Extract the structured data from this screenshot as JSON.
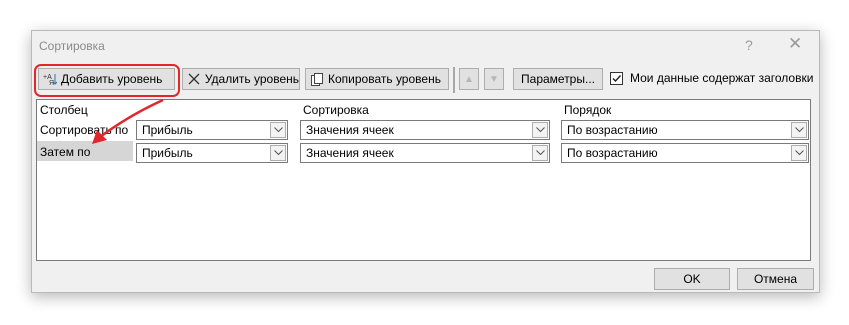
{
  "dialog": {
    "title": "Сортировка",
    "help": "?",
    "close": "✕"
  },
  "toolbar": {
    "add_level": "Добавить уровень",
    "delete_level": "Удалить уровень",
    "copy_level": "Копировать уровень",
    "params": "Параметры...",
    "my_data_headers": "Мои данные содержат заголовки",
    "my_data_headers_checked": true
  },
  "grid": {
    "headers": {
      "column": "Столбец",
      "sort": "Сортировка",
      "order": "Порядок"
    },
    "rows": [
      {
        "label": "Сортировать по",
        "column": "Прибыль",
        "sort_on": "Значения ячеек",
        "order": "По возрастанию"
      },
      {
        "label": "Затем по",
        "column": "Прибыль",
        "sort_on": "Значения ячеек",
        "order": "По возрастанию"
      }
    ]
  },
  "footer": {
    "ok": "OK",
    "cancel": "Отмена"
  },
  "colors": {
    "highlight": "#e3262c",
    "arrow": "#e3262c"
  }
}
